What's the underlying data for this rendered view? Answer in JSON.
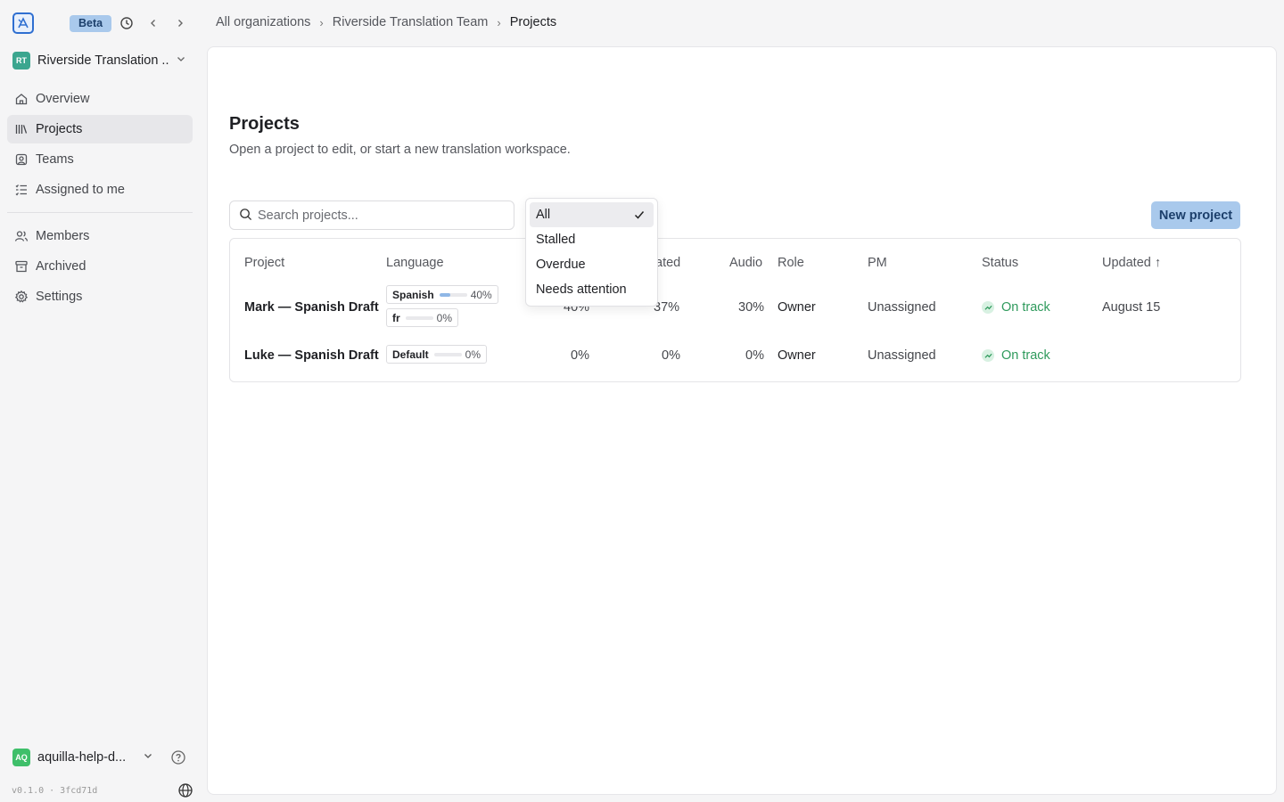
{
  "topbar": {
    "beta_label": "Beta",
    "breadcrumb": [
      "All organizations",
      "Riverside Translation Team",
      "Projects"
    ],
    "separator": "›"
  },
  "sidebar": {
    "org_initials": "RT",
    "org_name": "Riverside Translation ...",
    "items": [
      {
        "label": "Overview",
        "icon": "home-icon"
      },
      {
        "label": "Projects",
        "icon": "library-icon"
      },
      {
        "label": "Teams",
        "icon": "teams-icon"
      },
      {
        "label": "Assigned to me",
        "icon": "list-check-icon"
      },
      {
        "label": "Members",
        "icon": "users-icon"
      },
      {
        "label": "Archived",
        "icon": "archive-icon"
      },
      {
        "label": "Settings",
        "icon": "gear-icon"
      }
    ],
    "active_item": "Projects",
    "user_initials": "AQ",
    "user_name": "aquilla-help-d...",
    "version": "v0.1.0 · 3fcd71d"
  },
  "main": {
    "title": "Projects",
    "subtitle": "Open a project to edit, or start a new translation workspace.",
    "search_placeholder": "Search projects...",
    "new_project_label": "New project",
    "table": {
      "headers": {
        "project": "Project",
        "language": "Language",
        "translated": "ated",
        "audio": "Audio",
        "role": "Role",
        "pm": "PM",
        "status": "Status",
        "updated": "Updated",
        "updated_sort": "↑"
      },
      "rows": [
        {
          "project": "Mark — Spanish Draft",
          "languages": [
            {
              "name": "Spanish",
              "progress": 0.4,
              "pct": "40%"
            },
            {
              "name": "fr",
              "progress": 0.0,
              "pct": "0%"
            }
          ],
          "col3": "40%",
          "translated": "37%",
          "audio": "30%",
          "role": "Owner",
          "pm": "Unassigned",
          "status": "On track",
          "updated": "August 15"
        },
        {
          "project": "Luke — Spanish Draft",
          "languages": [
            {
              "name": "Default",
              "progress": 0.0,
              "pct": "0%"
            }
          ],
          "col3": "0%",
          "translated": "0%",
          "audio": "0%",
          "role": "Owner",
          "pm": "Unassigned",
          "status": "On track",
          "updated": ""
        }
      ]
    }
  },
  "filter_dropdown": {
    "options": [
      "All",
      "Stalled",
      "Overdue",
      "Needs attention"
    ],
    "selected": "All"
  },
  "colors": {
    "accent": "#a9c9ec",
    "status_green": "#2f9a5c",
    "org_badge": "#3ba68f",
    "user_badge": "#3fbf6a"
  }
}
